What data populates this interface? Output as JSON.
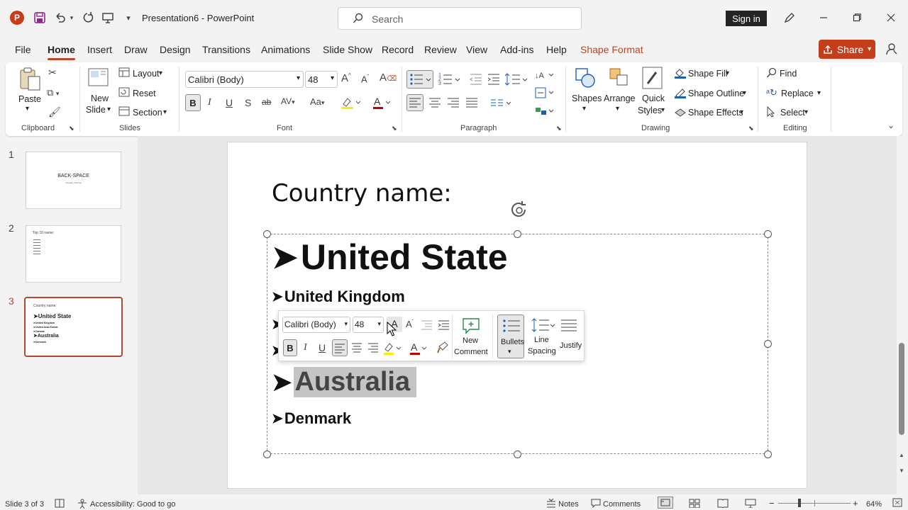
{
  "titlebar": {
    "doc_title": "Presentation6  -  PowerPoint",
    "search_placeholder": "Search",
    "sign_in": "Sign in"
  },
  "tabs": [
    "File",
    "Home",
    "Insert",
    "Draw",
    "Design",
    "Transitions",
    "Animations",
    "Slide Show",
    "Record",
    "Review",
    "View",
    "Add-ins",
    "Help",
    "Shape Format"
  ],
  "share_label": "Share",
  "ribbon": {
    "clipboard": {
      "paste": "Paste",
      "group": "Clipboard"
    },
    "slides": {
      "new_slide_1": "New",
      "new_slide_2": "Slide",
      "layout": "Layout",
      "reset": "Reset",
      "section": "Section",
      "group": "Slides"
    },
    "font": {
      "font_name": "Calibri (Body)",
      "font_size": "48",
      "group": "Font"
    },
    "paragraph": {
      "group": "Paragraph"
    },
    "drawing": {
      "shapes": "Shapes",
      "arrange": "Arrange",
      "quick_1": "Quick",
      "quick_2": "Styles",
      "shape_fill": "Shape Fill",
      "shape_outline": "Shape Outline",
      "shape_effects": "Shape Effects",
      "group": "Drawing"
    },
    "editing": {
      "find": "Find",
      "replace": "Replace",
      "select": "Select",
      "group": "Editing"
    }
  },
  "thumbnails": [
    {
      "num": "1",
      "title": "BACK-SPACE",
      "sub": "Youtube Channel"
    },
    {
      "num": "2",
      "title": "Top 10 name:"
    },
    {
      "num": "3",
      "title": "Country name:",
      "items": [
        "United State",
        "United Kingdom",
        "United Arab Emirat",
        "Canada",
        "Australia",
        "Denmark"
      ]
    }
  ],
  "slide": {
    "title": "Country name:",
    "items": [
      "United State",
      "United Kingdom",
      "Australia",
      "Denmark"
    ]
  },
  "mini_toolbar": {
    "font_name": "Calibri (Body)",
    "font_size": "48",
    "new_comment_1": "New",
    "new_comment_2": "Comment",
    "bullets": "Bullets",
    "line_spacing_1": "Line",
    "line_spacing_2": "Spacing",
    "justify": "Justify"
  },
  "status": {
    "slide_info": "Slide 3 of 3",
    "accessibility": "Accessibility: Good to go",
    "notes": "Notes",
    "comments": "Comments",
    "zoom": "64%"
  },
  "colors": {
    "accent": "#c43e1c",
    "tab_accent": "#b7472a"
  }
}
